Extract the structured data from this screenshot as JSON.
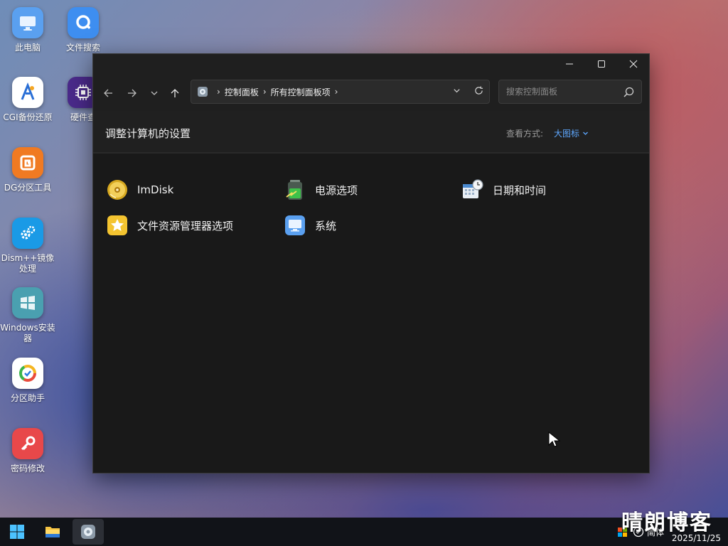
{
  "desktop": {
    "icons": [
      {
        "label": "此电脑",
        "icon": "monitor-icon"
      },
      {
        "label": "文件搜索",
        "icon": "search-app-icon"
      },
      {
        "label": "CGI备份还原",
        "icon": "cgi-icon"
      },
      {
        "label": "硬件查",
        "icon": "chip-icon"
      },
      {
        "label": "DG分区工具",
        "icon": "dg-icon"
      },
      {
        "label": "Dism++镜像处理",
        "icon": "gears-icon"
      },
      {
        "label": "Windows安装器",
        "icon": "windows-icon"
      },
      {
        "label": "分区助手",
        "icon": "partition-icon"
      },
      {
        "label": "密码修改",
        "icon": "key-icon"
      }
    ]
  },
  "window": {
    "breadcrumb": [
      "控制面板",
      "所有控制面板项"
    ],
    "search_placeholder": "搜索控制面板",
    "page_title": "调整计算机的设置",
    "view_by_label": "查看方式:",
    "view_by_value": "大图标",
    "items": [
      {
        "label": "ImDisk",
        "icon": "imdisk-icon"
      },
      {
        "label": "电源选项",
        "icon": "battery-icon"
      },
      {
        "label": "日期和时间",
        "icon": "calendar-clock-icon"
      },
      {
        "label": "文件资源管理器选项",
        "icon": "folder-options-icon"
      },
      {
        "label": "系统",
        "icon": "system-monitor-icon"
      }
    ]
  },
  "taskbar": {
    "ime": "简体",
    "date": "2025/11/25"
  },
  "watermark": "晴朗博客",
  "colors": {
    "window_bg": "#191919",
    "accent_link": "#5ea8ff",
    "taskbar_bg": "#111318"
  }
}
